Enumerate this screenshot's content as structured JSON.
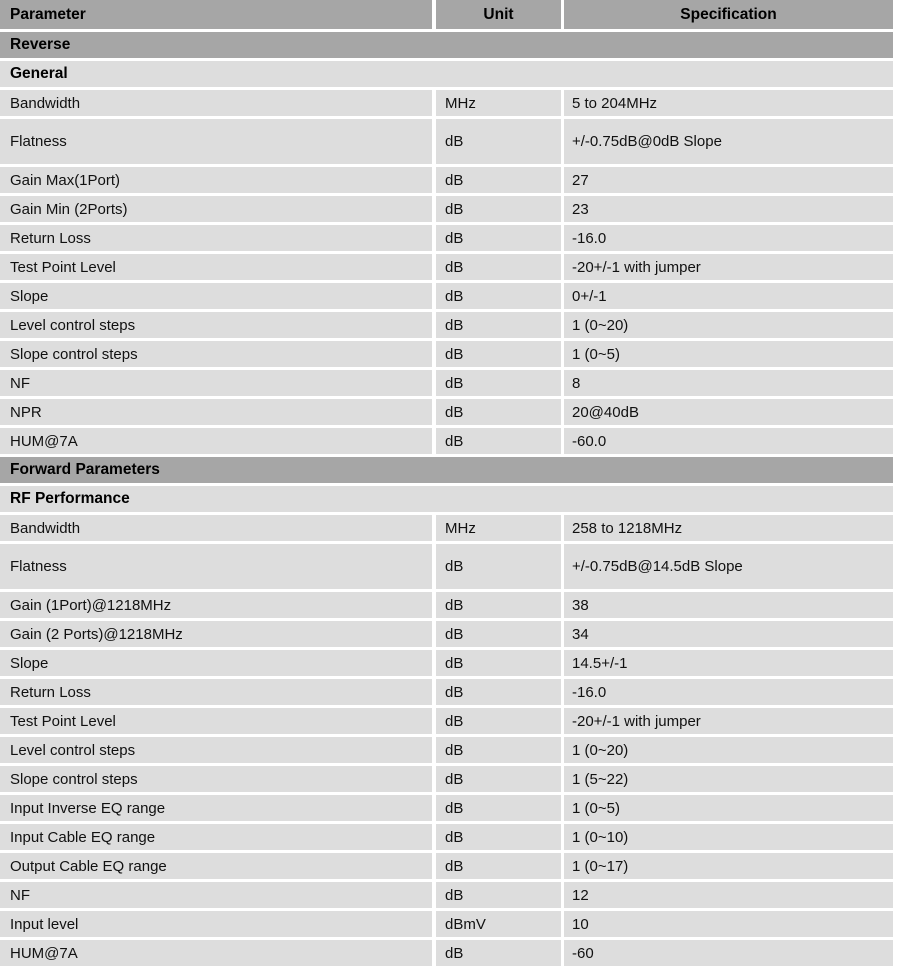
{
  "table": {
    "columns": [
      "Parameter",
      "Unit",
      "Specification"
    ],
    "colors": {
      "header_bg": "#a6a6a6",
      "section_dark_bg": "#a6a6a6",
      "section_light_bg": "#dddddd",
      "row_bg": "#dddddd",
      "gap": "#ffffff",
      "text": "#111111"
    },
    "rows": [
      {
        "kind": "section-dark",
        "label": "Reverse"
      },
      {
        "kind": "section-light",
        "label": "General"
      },
      {
        "kind": "data",
        "parameter": "Bandwidth",
        "unit": "MHz",
        "spec": "5 to 204MHz"
      },
      {
        "kind": "data",
        "tall": true,
        "parameter": "Flatness",
        "unit": "dB",
        "spec": "+/-0.75dB@0dB Slope"
      },
      {
        "kind": "data",
        "parameter": "Gain Max(1Port)",
        "unit": "dB",
        "spec": "27"
      },
      {
        "kind": "data",
        "parameter": "Gain Min (2Ports)",
        "unit": "dB",
        "spec": "23"
      },
      {
        "kind": "data",
        "parameter": "Return Loss",
        "unit": "dB",
        "spec": "-16.0"
      },
      {
        "kind": "data",
        "parameter": "Test Point Level",
        "unit": "dB",
        "spec": "-20+/-1 with jumper"
      },
      {
        "kind": "data",
        "parameter": "Slope",
        "unit": "dB",
        "spec": "0+/-1"
      },
      {
        "kind": "data",
        "parameter": "Level control steps",
        "unit": "dB",
        "spec": "1 (0~20)"
      },
      {
        "kind": "data",
        "parameter": "Slope control steps",
        "unit": "dB",
        "spec": "1 (0~5)"
      },
      {
        "kind": "data",
        "parameter": "NF",
        "unit": "dB",
        "spec": "8"
      },
      {
        "kind": "data",
        "parameter": "NPR",
        "unit": "dB",
        "spec": "20@40dB"
      },
      {
        "kind": "data",
        "parameter": "HUM@7A",
        "unit": "dB",
        "spec": "-60.0"
      },
      {
        "kind": "section-dark",
        "label": "Forward Parameters"
      },
      {
        "kind": "section-light",
        "label": "RF Performance"
      },
      {
        "kind": "data",
        "parameter": "Bandwidth",
        "unit": "MHz",
        "spec": "258 to 1218MHz"
      },
      {
        "kind": "data",
        "tall": true,
        "parameter": "Flatness",
        "unit": "dB",
        "spec": "+/-0.75dB@14.5dB Slope"
      },
      {
        "kind": "data",
        "parameter": "Gain (1Port)@1218MHz",
        "unit": "dB",
        "spec": "38"
      },
      {
        "kind": "data",
        "parameter": "Gain (2 Ports)@1218MHz",
        "unit": "dB",
        "spec": "34"
      },
      {
        "kind": "data",
        "parameter": "Slope",
        "unit": "dB",
        "spec": "14.5+/-1"
      },
      {
        "kind": "data",
        "parameter": "Return Loss",
        "unit": "dB",
        "spec": "-16.0"
      },
      {
        "kind": "data",
        "parameter": "Test Point Level",
        "unit": "dB",
        "spec": "-20+/-1 with jumper"
      },
      {
        "kind": "data",
        "parameter": "Level control steps",
        "unit": "dB",
        "spec": "1 (0~20)"
      },
      {
        "kind": "data",
        "parameter": "Slope control steps",
        "unit": "dB",
        "spec": "1 (5~22)"
      },
      {
        "kind": "data",
        "parameter": "Input Inverse EQ range",
        "unit": "dB",
        "spec": "1 (0~5)"
      },
      {
        "kind": "data",
        "parameter": "Input Cable EQ range",
        "unit": "dB",
        "spec": "1 (0~10)"
      },
      {
        "kind": "data",
        "parameter": "Output Cable EQ range",
        "unit": "dB",
        "spec": "1 (0~17)"
      },
      {
        "kind": "data",
        "parameter": "NF",
        "unit": "dB",
        "spec": "12"
      },
      {
        "kind": "data",
        "parameter": "Input level",
        "unit": "dBmV",
        "spec": "10"
      },
      {
        "kind": "data",
        "parameter": "HUM@7A",
        "unit": "dB",
        "spec": "-60"
      }
    ]
  }
}
